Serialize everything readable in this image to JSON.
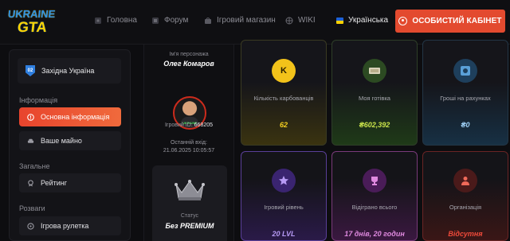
{
  "header": {
    "logo": {
      "line1": "UKRAINE",
      "line2": "GTA"
    },
    "nav": [
      {
        "label": "Головна",
        "icon": "home-icon"
      },
      {
        "label": "Форум",
        "icon": "forum-icon"
      },
      {
        "label": "Ігровий магазин",
        "icon": "shop-icon"
      },
      {
        "label": "WIKI",
        "icon": "globe-icon"
      }
    ],
    "language": "Українська",
    "cabinet_button": "ОСОБИСТИЙ КАБІНЕТ"
  },
  "sidebar": {
    "server": {
      "badge": "02",
      "name": "Західна Україна"
    },
    "sections": [
      {
        "title": "Інформація",
        "items": [
          {
            "label": "Основна інформація",
            "icon": "alert-icon",
            "active": true
          },
          {
            "label": "Ваше майно",
            "icon": "car-icon",
            "active": false
          }
        ]
      },
      {
        "title": "Загальне",
        "items": [
          {
            "label": "Рейтинг",
            "icon": "rating-icon",
            "active": false
          }
        ]
      },
      {
        "title": "Розваги",
        "items": [
          {
            "label": "Ігрова рулетка",
            "icon": "roulette-icon",
            "active": false
          }
        ]
      }
    ]
  },
  "profile": {
    "name_label": "Ім'я персонажа",
    "name": "Олег Комаров",
    "game_id_label": "Ігровий ID:",
    "game_id": "668205",
    "last_login_label": "Останній вхід:",
    "last_login": "21.06.2025 10:05:57",
    "status_label": "Статус",
    "status": "Без PREMIUM"
  },
  "stats": [
    {
      "label": "Кількість карбованців",
      "value": "62",
      "icon": "coin-k-icon",
      "value_color": "#f5d020"
    },
    {
      "label": "Моя готівка",
      "value": "₴602,392",
      "icon": "cash-icon",
      "value_color": "#c9e34a"
    },
    {
      "label": "Гроші на рахунках",
      "value": "₴0",
      "icon": "bank-icon",
      "value_color": "#9fd0f5"
    },
    {
      "label": "Ігровий рівень",
      "value": "20 LVL",
      "icon": "level-star-icon",
      "value_color": "#b79af5"
    },
    {
      "label": "Відіграно всього",
      "value": "17 днів, 20 годин",
      "icon": "trophy-icon",
      "value_color": "#e08ae0"
    },
    {
      "label": "Організація",
      "value": "Відсутня",
      "icon": "organization-icon",
      "value_color": "#f04a3a"
    }
  ]
}
